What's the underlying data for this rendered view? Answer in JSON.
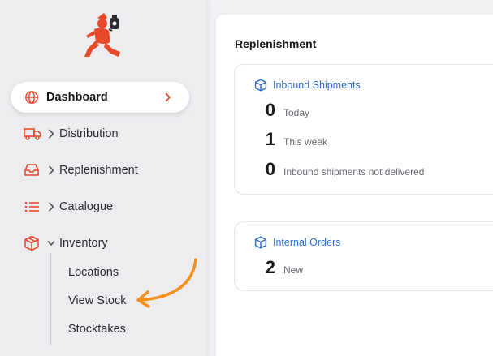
{
  "sidebar": {
    "items": [
      {
        "label": "Dashboard",
        "icon": "globe-icon"
      },
      {
        "label": "Distribution",
        "icon": "truck-icon"
      },
      {
        "label": "Replenishment",
        "icon": "inbox-icon"
      },
      {
        "label": "Catalogue",
        "icon": "list-icon"
      },
      {
        "label": "Inventory",
        "icon": "box-icon"
      }
    ],
    "inventory_subitems": [
      "Locations",
      "View Stock",
      "Stocktakes"
    ]
  },
  "main": {
    "section_title": "Replenishment",
    "inbound": {
      "title": "Inbound Shipments",
      "stats": [
        {
          "value": "0",
          "label": "Today"
        },
        {
          "value": "1",
          "label": "This week"
        },
        {
          "value": "0",
          "label": "Inbound shipments not delivered"
        }
      ]
    },
    "internal": {
      "title": "Internal Orders",
      "stats": [
        {
          "value": "2",
          "label": "New"
        }
      ]
    }
  },
  "colors": {
    "accent": "#e9492b",
    "link": "#2f6fc9",
    "annotation": "#f5901f"
  }
}
